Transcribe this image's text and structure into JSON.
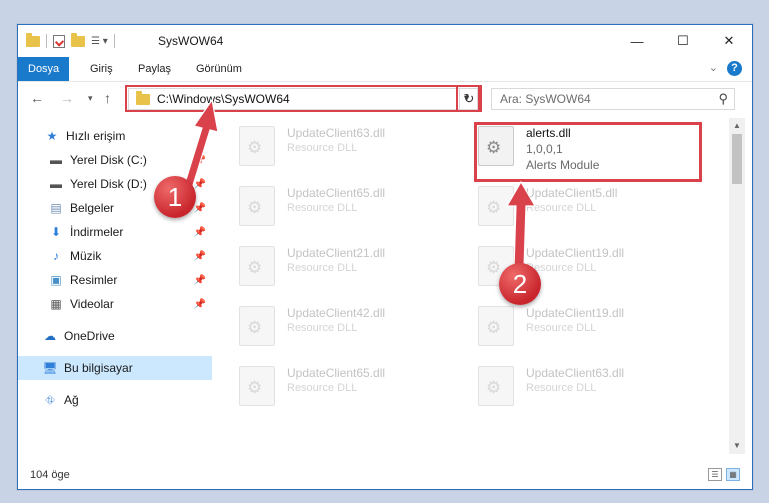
{
  "window": {
    "title": "SysWOW64",
    "minimize_icon": "minimize-icon",
    "maximize_icon": "maximize-icon",
    "close_icon": "close-icon"
  },
  "ribbon": {
    "tabs": [
      {
        "label": "Dosya",
        "active": true
      },
      {
        "label": "Giriş",
        "active": false
      },
      {
        "label": "Paylaş",
        "active": false
      },
      {
        "label": "Görünüm",
        "active": false
      }
    ],
    "help_label": "?"
  },
  "address_bar": {
    "path": "C:\\Windows\\SysWOW64"
  },
  "search": {
    "placeholder": "Ara: SysWOW64"
  },
  "nav_pane": {
    "items": [
      {
        "label": "Hızlı erişim",
        "icon": "star-icon",
        "pinned": false
      },
      {
        "label": "Yerel Disk (C:)",
        "icon": "drive-icon",
        "pinned": true
      },
      {
        "label": "Yerel Disk (D:)",
        "icon": "drive-icon",
        "pinned": true
      },
      {
        "label": "Belgeler",
        "icon": "document-icon",
        "pinned": true
      },
      {
        "label": "İndirmeler",
        "icon": "download-icon",
        "pinned": true
      },
      {
        "label": "Müzik",
        "icon": "music-icon",
        "pinned": true
      },
      {
        "label": "Resimler",
        "icon": "pictures-icon",
        "pinned": true
      },
      {
        "label": "Videolar",
        "icon": "video-icon",
        "pinned": true
      },
      {
        "label": "OneDrive",
        "icon": "cloud-icon",
        "pinned": false
      },
      {
        "label": "Bu bilgisayar",
        "icon": "computer-icon",
        "pinned": false,
        "selected": true
      },
      {
        "label": "Ağ",
        "icon": "network-icon",
        "pinned": false
      }
    ]
  },
  "files": [
    {
      "name": "UpdateClient63.dll",
      "desc": "Resource DLL"
    },
    {
      "name": "UpdateClient65.dll",
      "desc": "Resource DLL"
    },
    {
      "name": "UpdateClient21.dll",
      "desc": "Resource DLL"
    },
    {
      "name": "UpdateClient42.dll",
      "desc": "Resource DLL"
    },
    {
      "name": "UpdateClient65.dll",
      "desc": "Resource DLL"
    },
    {
      "name": "alerts.dll",
      "version": "1,0,0,1",
      "desc": "Alerts Module"
    },
    {
      "name": "UpdateClient5.dll",
      "desc": "Resource DLL"
    },
    {
      "name": "UpdateClient19.dll",
      "desc": "Resource DLL"
    },
    {
      "name": "UpdateClient19.dll",
      "desc": "Resource DLL"
    },
    {
      "name": "UpdateClient63.dll",
      "desc": "Resource DLL"
    }
  ],
  "status_bar": {
    "item_count": "104 öge"
  },
  "annotations": {
    "marker_1": "1",
    "marker_2": "2",
    "highlight_color": "#d9414b"
  }
}
